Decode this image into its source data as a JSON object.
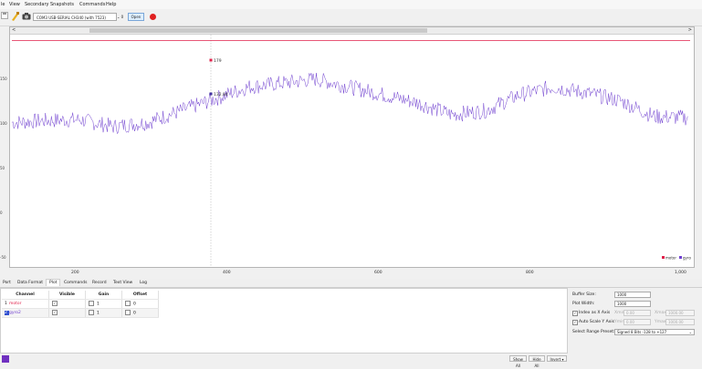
{
  "menu": [
    "le",
    "View",
    "Secondary",
    "Snapshots",
    "Commands",
    "Help"
  ],
  "toolbar": {
    "port": "COM3 USB-SERIAL CH340 (with 7523)",
    "baud_placeholder": "0",
    "open_label": "Open"
  },
  "plot": {
    "scroll_left_arrow": "<",
    "scroll_right_arrow": ">",
    "y_ticks": [
      "150",
      "100",
      "50",
      "0",
      "-50"
    ],
    "x_ticks": [
      "200",
      "400",
      "600",
      "800",
      "1,000"
    ],
    "marker1_label": "179",
    "marker2_label": "132.84",
    "legend": [
      {
        "name": "motor",
        "color": "#e0204a"
      },
      {
        "name": "gyro",
        "color": "#7040d0"
      }
    ]
  },
  "chart_data": {
    "type": "line",
    "x_range": [
      0,
      1000
    ],
    "y_range": [
      -50,
      185
    ],
    "series": [
      {
        "name": "motor",
        "color": "#e0204a",
        "constant": 179
      },
      {
        "name": "gyro",
        "color": "#7040d0",
        "x": [
          0,
          50,
          100,
          150,
          200,
          250,
          300,
          350,
          400,
          450,
          500,
          550,
          600,
          650,
          700,
          750,
          800,
          850,
          900,
          950,
          1000
        ],
        "y": [
          96,
          98,
          99,
          92,
          96,
          108,
          120,
          132,
          136,
          140,
          132,
          124,
          116,
          104,
          108,
          124,
          132,
          126,
          118,
          102,
          101
        ]
      }
    ]
  },
  "tabs": [
    "Port",
    "Data Format",
    "Plot",
    "Commands",
    "Record",
    "Text View",
    "Log"
  ],
  "active_tab": "Plot",
  "channels": {
    "headers": [
      "Channel",
      "Visible",
      "Gain",
      "Offset"
    ],
    "rows": [
      {
        "idx": "1",
        "name": "motor",
        "gain": "1",
        "offset": "0",
        "color": "#e0204a"
      },
      {
        "idx": "2",
        "name": "gyro2",
        "gain": "1",
        "offset": "0",
        "color": "#7040d0"
      }
    ]
  },
  "buttons": {
    "show_all": "Show All",
    "hide_all": "Hide All",
    "invert": "Invert"
  },
  "settings": {
    "buffer_size_label": "Buffer Size:",
    "buffer_size": "1000",
    "plot_width_label": "Plot Width:",
    "plot_width": "1000",
    "index_x_label": "Index as X Axis",
    "xmin_label": "Xmin",
    "xmin": "0.00",
    "xmax_label": "Xmax",
    "xmax": "1000.00",
    "autoscale_label": "Auto Scale Y Axis",
    "ymin_label": "Ymin",
    "ymin": "0.00",
    "ymax_label": "Ymax",
    "ymax": "1000.00",
    "range_preset_label": "Select Range Preset:",
    "range_preset": "Signed 8 Bits -128 to +127"
  }
}
